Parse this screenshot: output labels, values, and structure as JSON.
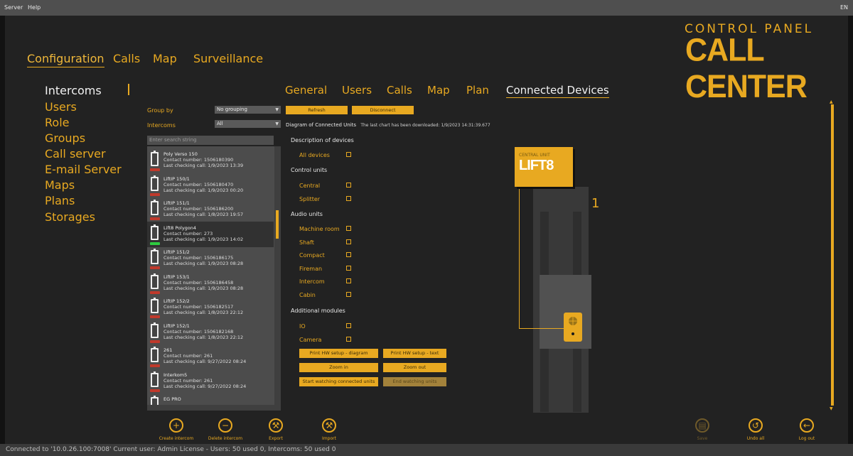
{
  "menubar": {
    "items": [
      "Server",
      "Help"
    ],
    "right_text": "EN"
  },
  "brand": {
    "line1": "CONTROL PANEL",
    "line2": "CALL CENTER"
  },
  "top_nav": [
    "Configuration",
    "Calls",
    "Map",
    "Surveillance"
  ],
  "side_nav": [
    "Intercoms",
    "Users",
    "Role",
    "Groups",
    "Call server",
    "E-mail Server",
    "Maps",
    "Plans",
    "Storages"
  ],
  "sub_tabs": [
    "General",
    "Users",
    "Calls",
    "Map",
    "Plan",
    "Connected Devices"
  ],
  "filters": {
    "group_by_label": "Group by",
    "group_by_value": "No grouping",
    "intercoms_label": "Intercoms",
    "intercoms_value": "All",
    "search_placeholder": "Enter search string"
  },
  "intercom_list": [
    {
      "name": "Poly Verso 150",
      "contact": "Contact number:  1506180390",
      "last": "Last checking call: 1/9/2023 13:39",
      "status_color": "#c0392b"
    },
    {
      "name": "LiftIP 150/1",
      "contact": "Contact number:  1506180470",
      "last": "Last checking call: 1/9/2023 00:20",
      "status_color": "#c0392b"
    },
    {
      "name": "LiftIP 151/1",
      "contact": "Contact number:  1506186200",
      "last": "Last checking call: 1/8/2023 19:57",
      "status_color": "#c0392b"
    },
    {
      "name": "Lift8 Polygon4",
      "contact": "Contact number:  273",
      "last": "Last checking call: 1/9/2023 14:02",
      "status_color": "#2ecc40"
    },
    {
      "name": "LiftIP 151/2",
      "contact": "Contact number:  1506186175",
      "last": "Last checking call: 1/9/2023 08:28",
      "status_color": "#c0392b"
    },
    {
      "name": "LiftIP 153/1",
      "contact": "Contact number:  1506186458",
      "last": "Last checking call: 1/9/2023 08:28",
      "status_color": "#c0392b"
    },
    {
      "name": "LiftIP 152/2",
      "contact": "Contact number:  1506182517",
      "last": "Last checking call: 1/8/2023 22:12",
      "status_color": "#c0392b"
    },
    {
      "name": "LiftIP 152/1",
      "contact": "Contact number:  1506182168",
      "last": "Last checking call: 1/8/2023 22:12",
      "status_color": "#c0392b"
    },
    {
      "name": "261",
      "contact": "Contact number:  261",
      "last": "Last checking call: 9/27/2022 08:24",
      "status_color": "#c0392b"
    },
    {
      "name": "Interkom5",
      "contact": "Contact number:  261",
      "last": "Last checking call: 9/27/2022 08:24",
      "status_color": "#c0392b"
    },
    {
      "name": "EG PRO",
      "contact": "",
      "last": "",
      "status_color": "#c0392b"
    }
  ],
  "actions": {
    "refresh": "Refresh",
    "disconnect": "Disconnect",
    "diagram_title": "Diagram of Connected Units",
    "last_download": "The last chart has been downloaded:  1/9/2023 14:31:39.677"
  },
  "devices": {
    "description": "Description of devices",
    "all_devices": "All devices",
    "control_units": "Control units",
    "central": "Central",
    "splitter": "Splitter",
    "audio_units": "Audio units",
    "audio": [
      "Machine room",
      "Shaft",
      "Compact",
      "Fireman",
      "Intercom",
      "Cabin"
    ],
    "additional_modules": "Additional modules",
    "io": "IO",
    "camera": "Camera"
  },
  "diagram_buttons": {
    "print_diagram": "Print HW setup - diagram",
    "print_text": "Print HW setup - text",
    "zoom_in": "Zoom in",
    "zoom_out": "Zoom out",
    "start_watch": "Start watching connected units",
    "end_watch": "End watching units"
  },
  "diagram": {
    "central_label": "CENTRAL UNIT",
    "logo": "LIFT8",
    "shaft_number": "1"
  },
  "bottom_actions": {
    "create": "Create intercom",
    "delete": "Delete intercom",
    "export": "Export",
    "import": "Import",
    "save": "Save",
    "undo": "Undo all",
    "logout": "Log out"
  },
  "status": "Connected to '10.0.26.100:7008'   Current user: Admin    License - Users: 50 used 0, Intercoms: 50 used 0",
  "colors": {
    "accent": "#e8a921",
    "background": "#222222"
  }
}
